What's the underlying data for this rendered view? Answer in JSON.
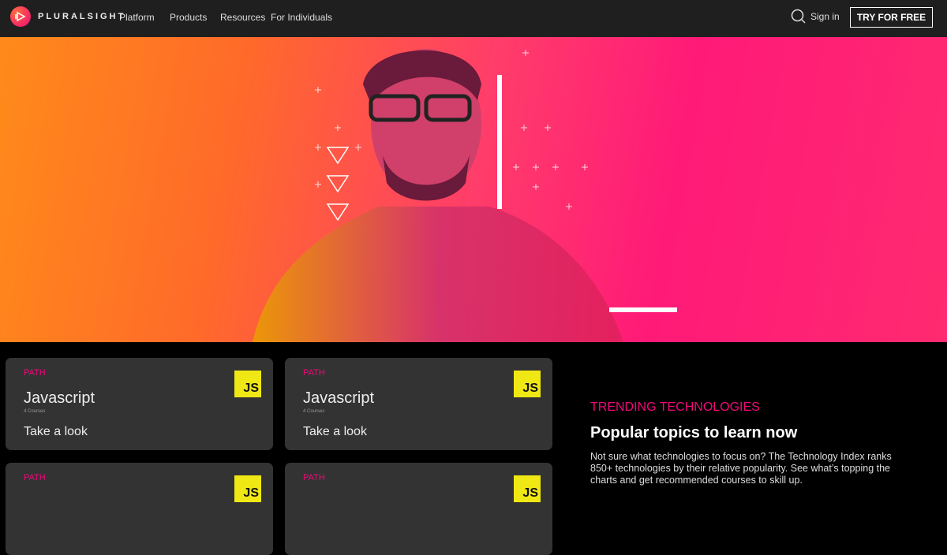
{
  "nav": {
    "brand": "PLURALSIGHT",
    "links": [
      "Platform",
      "Products",
      "Resources",
      "For Individuals"
    ],
    "sign_in": "Sign in",
    "cta": "TRY FOR FREE"
  },
  "cards": [
    {
      "kind": "PATH",
      "title": "Javascript",
      "count": "4 Courses",
      "cta": "Take a look",
      "badge": "JS"
    },
    {
      "kind": "PATH",
      "title": "Javascript",
      "count": "4 Courses",
      "cta": "Take a look",
      "badge": "JS"
    },
    {
      "kind": "PATH",
      "badge": "JS"
    },
    {
      "kind": "PATH",
      "badge": "JS"
    }
  ],
  "trending": {
    "kicker": "TRENDING TECHNOLOGIES",
    "title": "Popular topics to learn now",
    "body": "Not sure what technologies to focus on? The Technology Index ranks 850+ technologies by their relative popularity. See what’s topping the charts and get recommended courses to skill up."
  },
  "colors": {
    "accent": "#f0087a",
    "nav": "#1f1f1f",
    "card": "#333333",
    "js": "#f0e814"
  }
}
